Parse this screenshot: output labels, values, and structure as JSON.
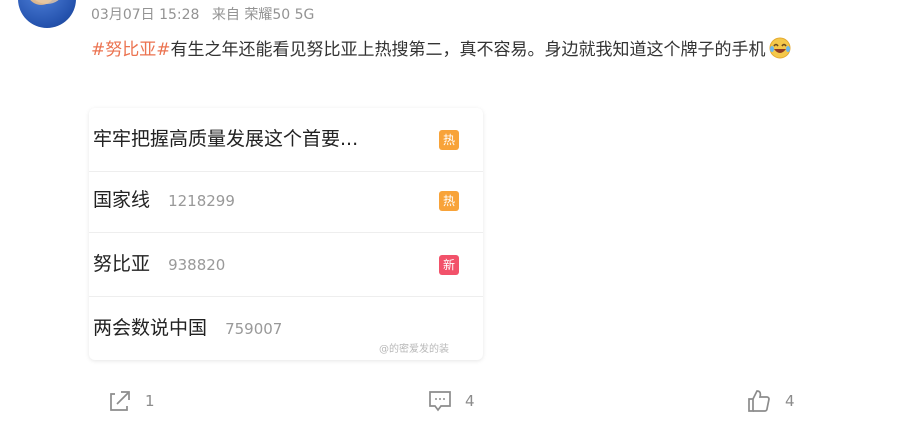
{
  "meta": {
    "datetime": "03月07日 15:28",
    "source": "来自 荣耀50 5G"
  },
  "post": {
    "topic": "#努比亚#",
    "text": "有生之年还能看见努比亚上热搜第二，真不容易。身边就我知道这个牌子的手机",
    "emoji": "laugh-cry-emoji"
  },
  "hot_list": [
    {
      "title": "牢牢把握高质量发展这个首要...",
      "count": "",
      "badge": "热",
      "badge_type": "hot"
    },
    {
      "title": "国家线",
      "count": "1218299",
      "badge": "热",
      "badge_type": "hot"
    },
    {
      "title": "努比亚",
      "count": "938820",
      "badge": "新",
      "badge_type": "new"
    },
    {
      "title": "两会数说中国",
      "count": "759007",
      "badge": "",
      "badge_type": ""
    }
  ],
  "watermark": "@的密爱发的装",
  "actions": {
    "repost": {
      "icon": "share-icon",
      "count": "1"
    },
    "comment": {
      "icon": "comment-icon",
      "count": "4"
    },
    "like": {
      "icon": "thumbs-up-icon",
      "count": "4"
    }
  },
  "colors": {
    "topic": "#eb7350",
    "hot_badge": "#f8a339",
    "new_badge": "#f2526a",
    "meta_text": "#939393"
  }
}
